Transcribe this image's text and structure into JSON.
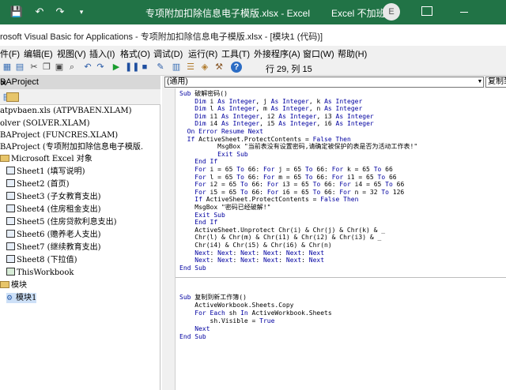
{
  "excel_window": {
    "title": "专项附加扣除信息电子模版.xlsx  -  Excel",
    "user_label": "Excel 不加班",
    "avatar_letter": "E"
  },
  "vbe_window": {
    "title": "rosoft Visual Basic for Applications - 专项附加扣除信息电子模版.xlsx - [模块1 (代码)]"
  },
  "menu": [
    "件(F)",
    "编辑(E)",
    "视图(V)",
    "插入(I)",
    "格式(O)",
    "调试(D)",
    "运行(R)",
    "工具(T)",
    "外接程序(A)",
    "窗口(W)",
    "帮助(H)"
  ],
  "toolbar": {
    "status": "行 29, 列 15"
  },
  "project_explorer": {
    "title": "BAProject",
    "close_glyph": "✕",
    "items": [
      "atpvbaen.xls (ATPVBAEN.XLAM)",
      "olver (SOLVER.XLAM)",
      "BAProject (FUNCRES.XLAM)",
      "BAProject (专项附加扣除信息电子模版.",
      "Microsoft Excel 对象",
      "Sheet1 (填写说明)",
      "Sheet2 (首页)",
      "Sheet3 (子女教育支出)",
      "Sheet4 (住房租金支出)",
      "Sheet5 (住房贷款利息支出)",
      "Sheet6 (赡养老人支出)",
      "Sheet7 (继续教育支出)",
      "Sheet8 (下拉值)",
      "ThisWorkbook",
      "模块",
      "模块1"
    ]
  },
  "code_window": {
    "object_combo": "(通用)",
    "procedure_combo": "复制到",
    "lines": [
      "Sub 破解密码()",
      "    Dim i As Integer, j As Integer, k As Integer",
      "    Dim l As Integer, m As Integer, n As Integer",
      "    Dim i1 As Integer, i2 As Integer, i3 As Integer",
      "    Dim i4 As Integer, i5 As Integer, i6 As Integer",
      "  On Error Resume Next",
      "  If ActiveSheet.ProtectContents = False Then",
      "          MsgBox \"当前表没有设置密码,请确定被保护的表是否为活动工作表!\"",
      "          Exit Sub",
      "    End If",
      "    For i = 65 To 66: For j = 65 To 66: For k = 65 To 66",
      "    For l = 65 To 66: For m = 65 To 66: For i1 = 65 To 66",
      "    For i2 = 65 To 66: For i3 = 65 To 66: For i4 = 65 To 66",
      "    For i5 = 65 To 66: For i6 = 65 To 66: For n = 32 To 126",
      "    If ActiveSheet.ProtectContents = False Then",
      "    MsgBox \"密码已经破解!\"",
      "    Exit Sub",
      "    End If",
      "    ActiveSheet.Unprotect Chr(i) & Chr(j) & Chr(k) & _",
      "    Chr(l) & Chr(m) & Chr(i1) & Chr(i2) & Chr(i3) & _",
      "    Chr(i4) & Chr(i5) & Chr(i6) & Chr(n)",
      "    Next: Next: Next: Next: Next: Next",
      "    Next: Next: Next: Next: Next: Next",
      "End Sub",
      "Sub 复制到新工作簿()",
      "    ActiveWorkbook.Sheets.Copy",
      "    For Each sh In ActiveWorkbook.Sheets",
      "        sh.Visible = True",
      "    Next",
      "End Sub"
    ]
  },
  "colors": {
    "excel_green": "#217346",
    "keyword_blue": "#0000a0",
    "selection": "#cde0f7"
  }
}
